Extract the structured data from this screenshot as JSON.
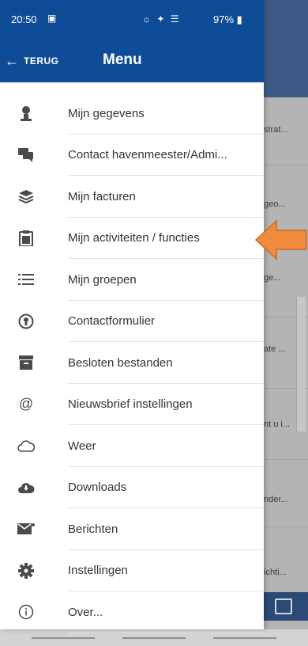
{
  "status_bar": {
    "time": "20:50",
    "battery": "97%"
  },
  "header": {
    "back_label": "TERUG",
    "title": "Menu"
  },
  "menu": [
    {
      "label": "Mijn gegevens",
      "icon": "person-icon"
    },
    {
      "label": "Contact havenmeester/Admi...",
      "icon": "chat-icon"
    },
    {
      "label": "Mijn facturen",
      "icon": "layers-icon"
    },
    {
      "label": "Mijn activiteiten / functies",
      "icon": "clipboard-icon"
    },
    {
      "label": "Mijn groepen",
      "icon": "list-icon"
    },
    {
      "label": "Contactformulier",
      "icon": "contact-icon"
    },
    {
      "label": "Besloten bestanden",
      "icon": "archive-icon"
    },
    {
      "label": "Nieuwsbrief instellingen",
      "icon": "at-icon"
    },
    {
      "label": "Weer",
      "icon": "cloud-icon"
    },
    {
      "label": "Downloads",
      "icon": "cloud-download-icon"
    },
    {
      "label": "Berichten",
      "icon": "mail-icon"
    },
    {
      "label": "Instellingen",
      "icon": "gear-icon"
    },
    {
      "label": "Over...",
      "icon": "info-icon"
    }
  ],
  "background_snippets": [
    "strat...",
    "geo...",
    "ge...",
    "ate ...",
    "nt u i...",
    "nder...",
    "ichti..."
  ],
  "colors": {
    "header_blue": "#0f4c97",
    "annotation_orange": "#f08a3c"
  }
}
